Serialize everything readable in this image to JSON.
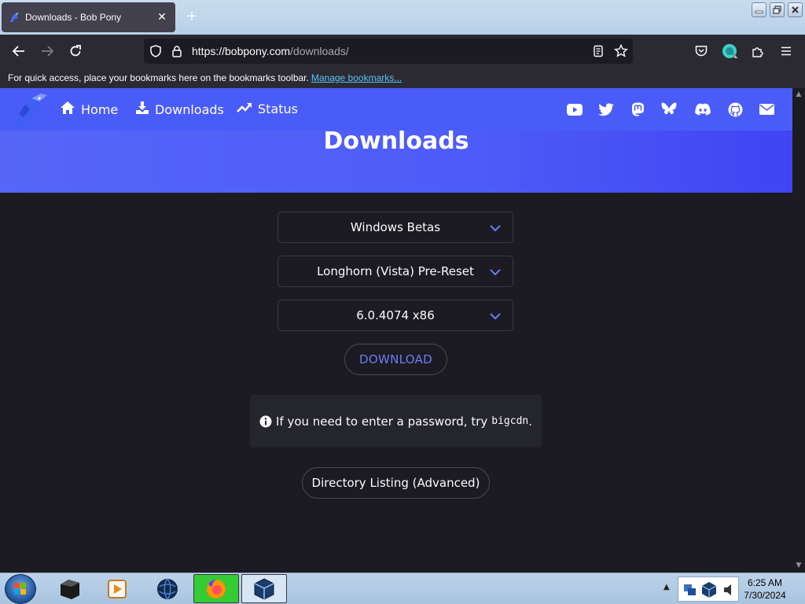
{
  "browser": {
    "tab_title": "Downloads - Bob Pony",
    "tab_close": "✕",
    "new_tab": "+",
    "url_host": "https://bobpony.com",
    "url_path": "/downloads/",
    "bookmarks_hint": "For quick access, place your bookmarks here on the bookmarks toolbar.",
    "bookmarks_link": "Manage bookmarks..."
  },
  "site": {
    "nav": [
      {
        "label": "Home",
        "icon": "home-icon"
      },
      {
        "label": "Downloads",
        "icon": "download-icon"
      },
      {
        "label": "Status",
        "icon": "trend-icon"
      }
    ],
    "social_icons": [
      "youtube-icon",
      "twitter-icon",
      "mastodon-icon",
      "bluesky-icon",
      "discord-icon",
      "github-icon",
      "email-icon"
    ],
    "brand_color": "#4a5cf8",
    "page_title": "Downloads"
  },
  "form": {
    "category": "Windows Betas",
    "product": "Longhorn (Vista) Pre-Reset",
    "build": "6.0.4074 x86",
    "download_label": "DOWNLOAD",
    "notice_text": "If you need to enter a password, try",
    "notice_code": "bigcdn",
    "notice_end": ".",
    "dirlist_label": "Directory Listing (Advanced)"
  },
  "taskbar": {
    "time": "6:25 AM",
    "date": "7/30/2024"
  }
}
